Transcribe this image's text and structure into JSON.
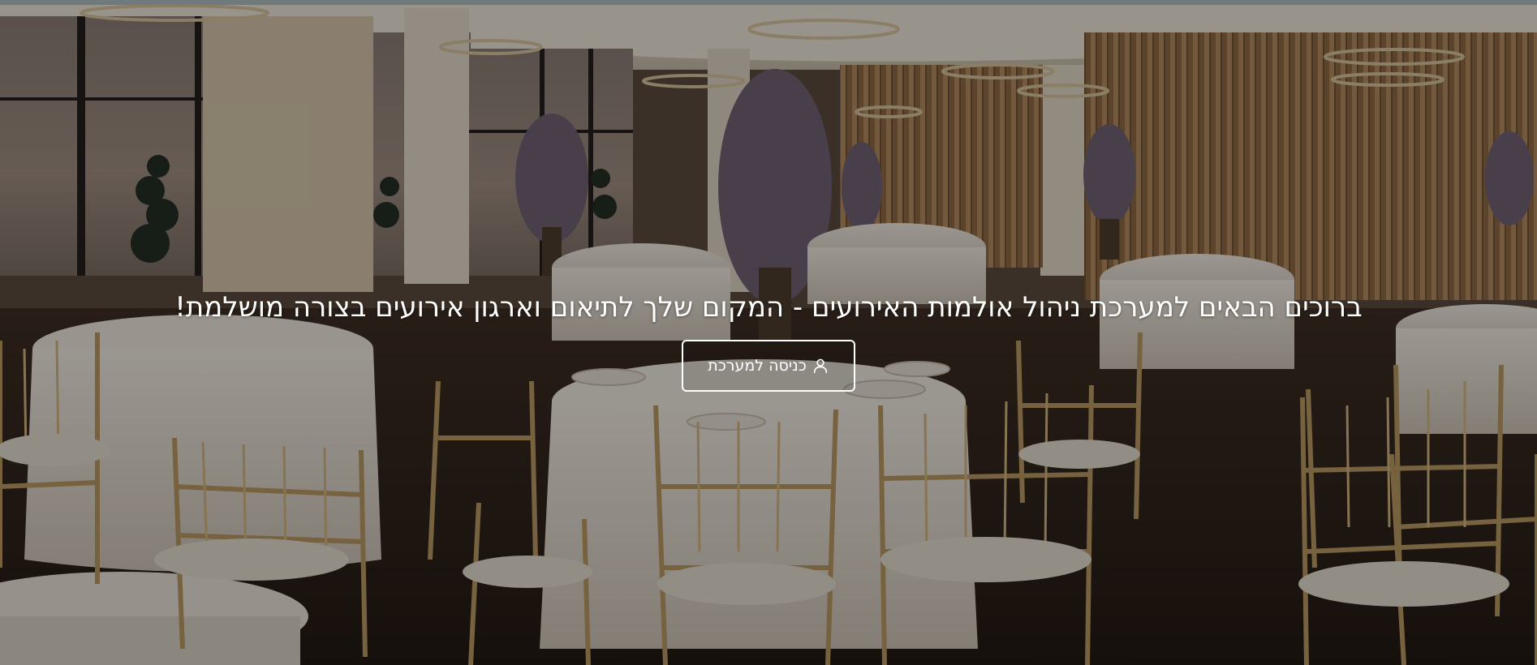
{
  "hero": {
    "headline": "ברוכים הבאים למערכת ניהול אולמות האירועים - המקום שלך לתיאום וארגון אירועים בצורה מושלמת!",
    "login_button": {
      "label": "כניסה למערכת",
      "icon": "user-icon"
    }
  },
  "colors": {
    "text": "#ffffff",
    "button_border": "#ffffff",
    "top_strip": "#6f7a7c"
  }
}
